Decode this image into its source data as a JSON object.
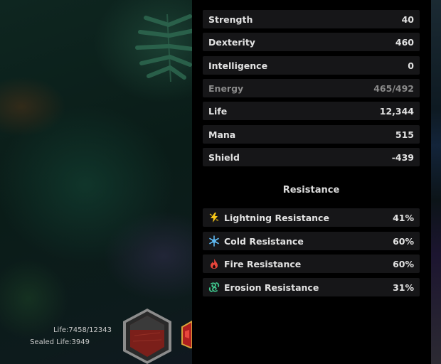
{
  "stats": [
    {
      "label": "Strength",
      "value": "40"
    },
    {
      "label": "Dexterity",
      "value": "460"
    },
    {
      "label": "Intelligence",
      "value": "0"
    },
    {
      "label": "Energy",
      "value": "465/492"
    },
    {
      "label": "Life",
      "value": "12,344"
    },
    {
      "label": "Mana",
      "value": "515"
    },
    {
      "label": "Shield",
      "value": "-439"
    }
  ],
  "resistance": {
    "title": "Resistance",
    "items": [
      {
        "label": "Lightning Resistance",
        "value": "41%",
        "icon": "lightning-icon",
        "color": "#f5c518"
      },
      {
        "label": "Cold Resistance",
        "value": "60%",
        "icon": "snowflake-icon",
        "color": "#5fb8f0"
      },
      {
        "label": "Fire Resistance",
        "value": "60%",
        "icon": "flame-icon",
        "color": "#e8463c"
      },
      {
        "label": "Erosion Resistance",
        "value": "31%",
        "icon": "erosion-icon",
        "color": "#3fc48c"
      }
    ]
  },
  "hud": {
    "life": "Life:7458/12343",
    "sealed_life": "Sealed Life:3949"
  }
}
